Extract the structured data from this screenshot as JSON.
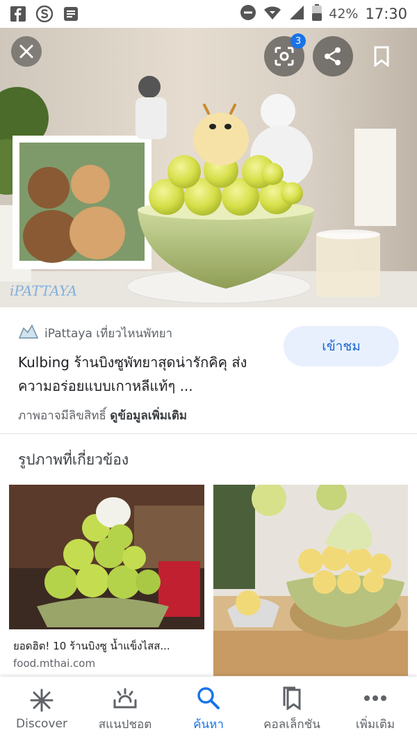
{
  "status_bar": {
    "battery": "42%",
    "time": "17:30",
    "left_icons": [
      "facebook-icon",
      "s-app-icon",
      "news-icon"
    ]
  },
  "hero": {
    "watermark": "iPATTAYA",
    "lens_badge": "3"
  },
  "result": {
    "source": "iPattaya เที่ยวไหนพัทยา",
    "title": "Kulbing ร้านบิงซูพัทยาสุดน่ารักคิคุ ส่งความอร่อยแบบเกาหลีแท้ๆ ...",
    "visit_label": "เข้าชม",
    "copyright_prefix": "ภาพอาจมีลิขสิทธิ์",
    "copyright_link": "ดูข้อมูลเพิ่มเติม"
  },
  "related": {
    "heading": "รูปภาพที่เกี่ยวข้อง",
    "items": [
      {
        "caption": "ยอดฮิต! 10 ร้านบิงซู น้ำแข็งไสส...",
        "domain": "food.mthai.com"
      },
      {
        "caption": "",
        "domain": ""
      }
    ]
  },
  "bottom_nav": {
    "items": [
      {
        "label": "Discover",
        "icon": "asterisk-icon"
      },
      {
        "label": "สแนปชอต",
        "icon": "snapshot-icon"
      },
      {
        "label": "ค้นหา",
        "icon": "search-icon"
      },
      {
        "label": "คอลเล็กชัน",
        "icon": "collections-icon"
      },
      {
        "label": "เพิ่มเติม",
        "icon": "more-icon"
      }
    ],
    "active_index": 2
  },
  "colors": {
    "accent": "#1a73e8",
    "visit_bg": "#e8f0fe",
    "melon": "#d9e35a",
    "bowl": "#b9c98a"
  }
}
